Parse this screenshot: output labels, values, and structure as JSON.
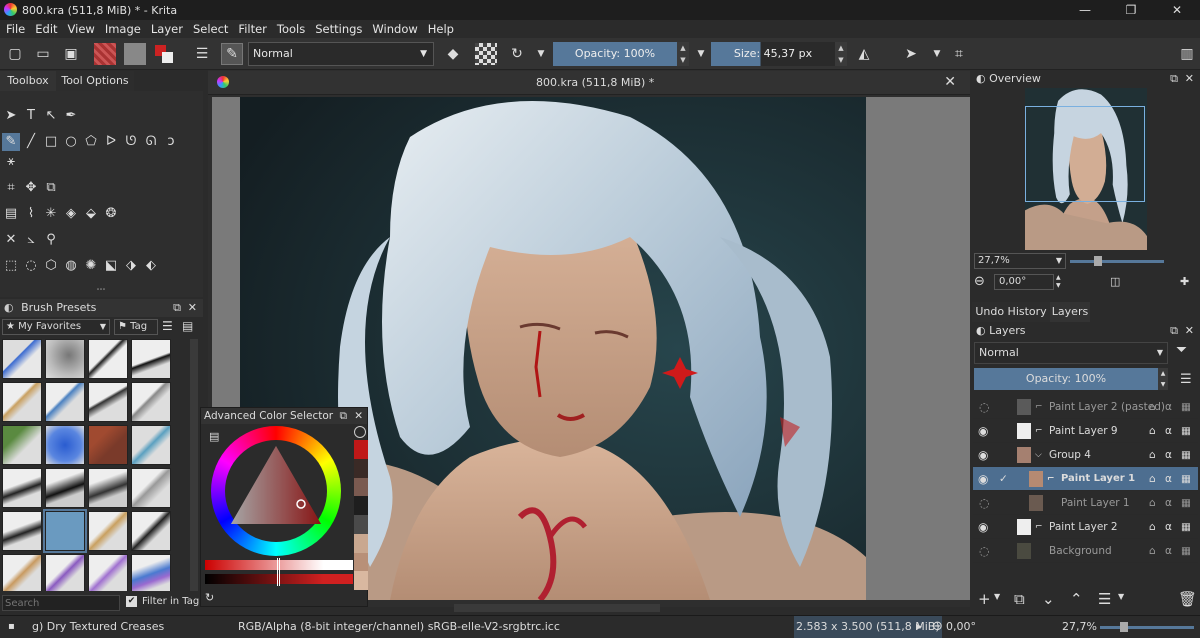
{
  "window": {
    "title": "800.kra (511,8 MiB) * - Krita",
    "min": "—",
    "max": "❐",
    "close": "✕"
  },
  "menu": [
    "File",
    "Edit",
    "View",
    "Image",
    "Layer",
    "Select",
    "Filter",
    "Tools",
    "Settings",
    "Window",
    "Help"
  ],
  "toolbar": {
    "blend_mode": "Normal",
    "opacity": "Opacity: 100%",
    "size": "Size: 45,37 px"
  },
  "left_tabs": {
    "toolbox": "Toolbox",
    "tool_options": "Tool Options"
  },
  "brush_presets": {
    "title": "Brush Presets",
    "filter": "My Favorites",
    "tag": "Tag",
    "search_placeholder": "Search",
    "filter_in_tag": "Filter in Tag"
  },
  "color_selector": {
    "title": "Advanced Color Selector"
  },
  "document": {
    "tab_title": "800.kra (511,8 MiB) *"
  },
  "overview": {
    "title": "Overview",
    "zoom": "27,7%",
    "rotation": "0,00°"
  },
  "right_tabs": {
    "undo": "Undo History",
    "layers": "Layers"
  },
  "layers": {
    "title": "Layers",
    "blend_mode": "Normal",
    "opacity": "Opacity:  100%",
    "items": [
      {
        "name": "Paint Layer 2 (pasted)",
        "visible": false,
        "indent": 1
      },
      {
        "name": "Paint Layer 9",
        "visible": true,
        "indent": 1
      },
      {
        "name": "Group 4",
        "visible": true,
        "indent": 1
      },
      {
        "name": "Paint Layer 1",
        "visible": true,
        "indent": 2,
        "selected": true
      },
      {
        "name": "Paint Layer 1",
        "visible": false,
        "indent": 2
      },
      {
        "name": "Paint Layer 2",
        "visible": true,
        "indent": 1
      },
      {
        "name": "Background",
        "visible": false,
        "indent": 0
      }
    ]
  },
  "status": {
    "brush": "g) Dry Textured Creases",
    "color_space": "RGB/Alpha (8-bit integer/channel)  sRGB-elle-V2-srgbtrc.icc",
    "dimensions": "2.583 x 3.500 (511,8 MiB)",
    "rotation": "0,00°",
    "zoom": "27,7%"
  },
  "colors": {
    "accent": "#56789a",
    "selected_layer": "#4d6e90"
  }
}
